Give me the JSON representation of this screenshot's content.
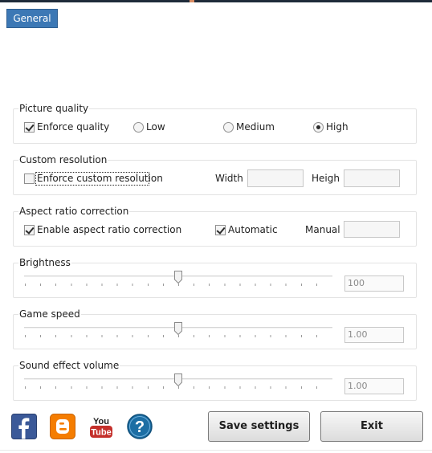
{
  "tabs": {
    "general": "General"
  },
  "picture_quality": {
    "title": "Picture quality",
    "enforce_label": "Enforce quality",
    "enforce_checked": true,
    "options": [
      "Low",
      "Medium",
      "High"
    ],
    "selected": "High"
  },
  "custom_resolution": {
    "title": "Custom resolution",
    "enforce_label": "Enforce custom resolution",
    "enforce_checked": false,
    "width_label": "Width",
    "width_value": "",
    "height_label": "Heigh",
    "height_value": ""
  },
  "aspect_ratio": {
    "title": "Aspect ratio correction",
    "enable_label": "Enable aspect ratio correction",
    "enable_checked": true,
    "automatic_label": "Automatic",
    "automatic_checked": true,
    "manual_label": "Manual",
    "manual_value": ""
  },
  "brightness": {
    "title": "Brightness",
    "value": "100",
    "level": 0.5
  },
  "game_speed": {
    "title": "Game speed",
    "value": "1.00",
    "level": 0.5
  },
  "sound_effect_volume": {
    "title": "Sound effect volume",
    "value": "1.00",
    "level": 0.5
  },
  "social": {
    "facebook": "facebook-icon",
    "blogger": "blogger-icon",
    "youtube": {
      "icon": "youtube-icon",
      "line1": "You",
      "line2": "Tube"
    },
    "help": {
      "icon": "help-icon",
      "glyph": "?"
    }
  },
  "buttons": {
    "save": "Save settings",
    "exit": "Exit"
  },
  "colors": {
    "accent": "#3c78b5",
    "facebook": "#3b5998",
    "blogger": "#f57d00",
    "youtube": "#c4302b",
    "help": "#1c6ea4"
  }
}
